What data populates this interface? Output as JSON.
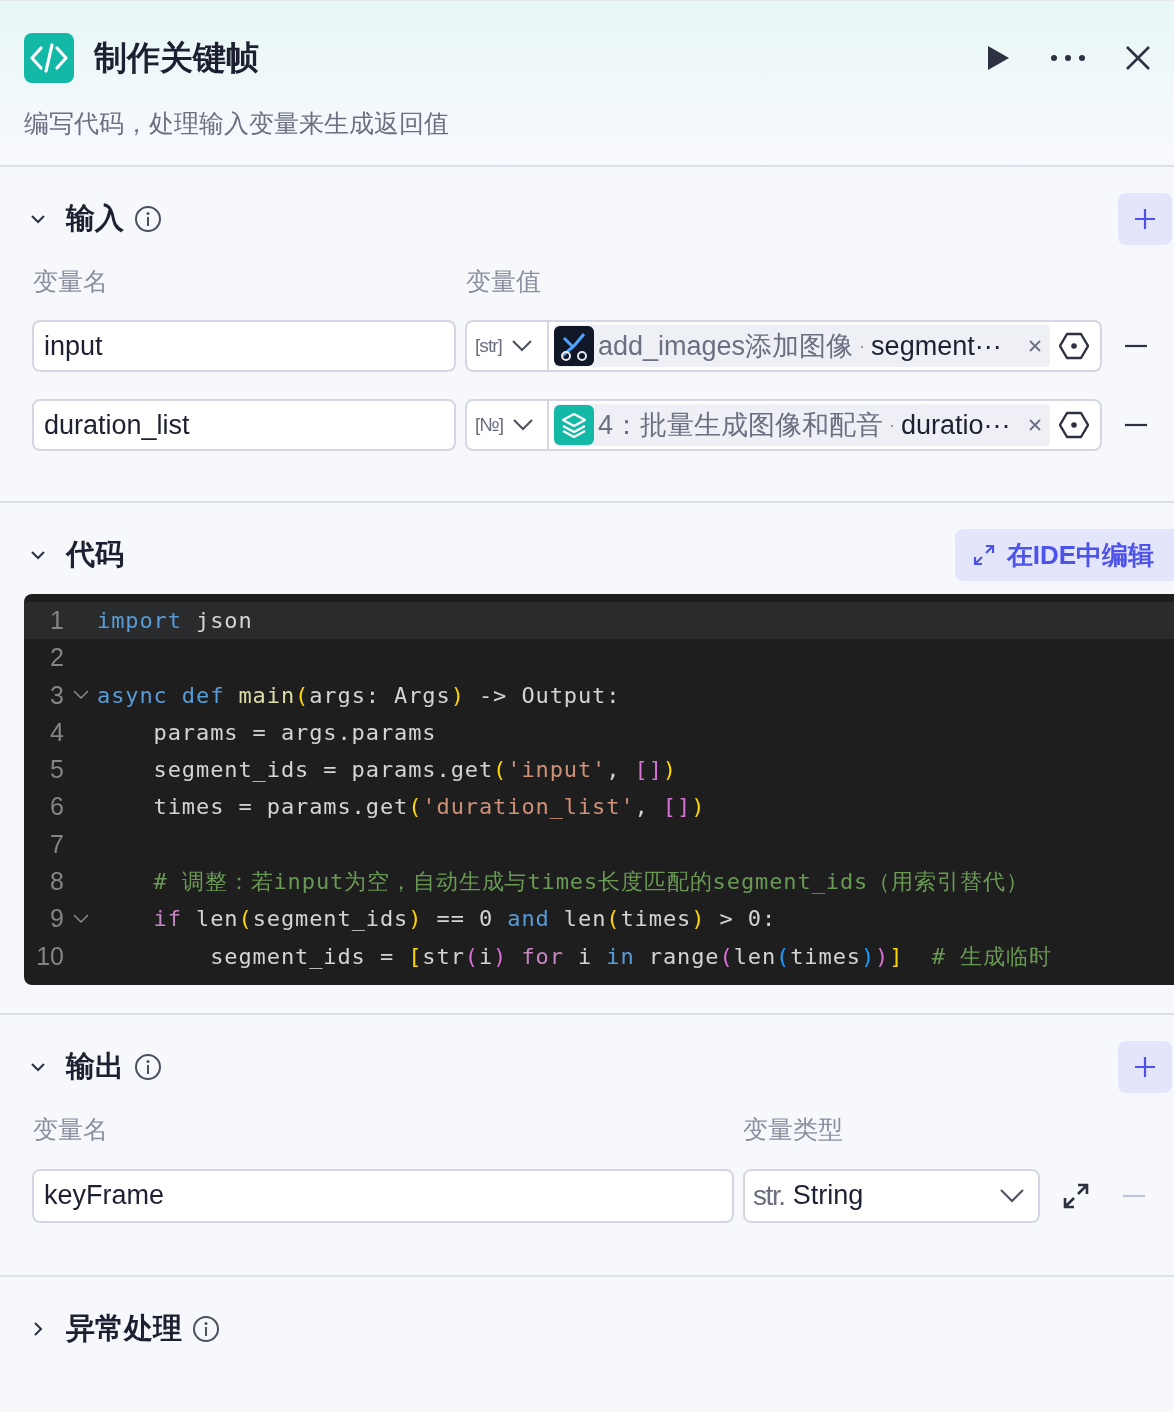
{
  "header": {
    "title": "制作关键帧",
    "description": "编写代码，处理输入变量来生成返回值"
  },
  "input": {
    "title": "输入",
    "expanded": true,
    "columns": [
      "变量名",
      "变量值"
    ],
    "rows": [
      {
        "name": "input",
        "type_tag": "[str]",
        "kind": "image",
        "source_node": "add_images添加图像",
        "separator": "·",
        "source_field": "segment···",
        "remove_disabled": false
      },
      {
        "name": "duration_list",
        "type_tag": "[№]",
        "kind": "layers",
        "source_node": "4：批量生成图像和配音",
        "separator": "·",
        "source_field": "duratio···",
        "remove_disabled": false
      }
    ]
  },
  "code": {
    "title": "代码",
    "expanded": true,
    "ide_button": "在IDE中编辑",
    "lines": [
      {
        "number": "1",
        "foldable": false,
        "tokens": [
          {
            "kind": "kw",
            "text": "import"
          },
          {
            "kind": "plain",
            "text": " json"
          }
        ]
      },
      {
        "number": "2",
        "foldable": false
      },
      {
        "number": "3",
        "foldable": true,
        "tokens": [
          {
            "kind": "kw",
            "text": "async def "
          },
          {
            "kind": "fn",
            "text": "main"
          },
          {
            "kind": "b1",
            "text": "("
          },
          {
            "kind": "plain",
            "text": "args: Args"
          },
          {
            "kind": "b1",
            "text": ")"
          },
          {
            "kind": "plain",
            "text": " -> Output:"
          }
        ]
      },
      {
        "number": "4",
        "foldable": false,
        "tokens": [
          {
            "kind": "plain",
            "text": "    params = args.params"
          }
        ]
      },
      {
        "number": "5",
        "foldable": false,
        "tokens": [
          {
            "kind": "plain",
            "text": "    segment_ids = params.get"
          },
          {
            "kind": "b1",
            "text": "("
          },
          {
            "kind": "str",
            "text": "'input'"
          },
          {
            "kind": "plain",
            "text": ", "
          },
          {
            "kind": "b2",
            "text": "[]"
          },
          {
            "kind": "b1",
            "text": ")"
          }
        ]
      },
      {
        "number": "6",
        "foldable": false,
        "tokens": [
          {
            "kind": "plain",
            "text": "    times = params.get"
          },
          {
            "kind": "b1",
            "text": "("
          },
          {
            "kind": "str",
            "text": "'duration_list'"
          },
          {
            "kind": "plain",
            "text": ", "
          },
          {
            "kind": "b2",
            "text": "[]"
          },
          {
            "kind": "b1",
            "text": ")"
          }
        ]
      },
      {
        "number": "7",
        "foldable": false
      },
      {
        "number": "8",
        "foldable": false,
        "tokens": [
          {
            "kind": "comment",
            "text": "    # 调整：若input为空，自动生成与times长度匹配的segment_ids（用索引替代）"
          }
        ]
      },
      {
        "number": "9",
        "foldable": true,
        "tokens": [
          {
            "kind": "ctrl",
            "text": "    if"
          },
          {
            "kind": "plain",
            "text": " len"
          },
          {
            "kind": "b1",
            "text": "("
          },
          {
            "kind": "plain",
            "text": "segment_ids"
          },
          {
            "kind": "b1",
            "text": ")"
          },
          {
            "kind": "plain",
            "text": " == 0 "
          },
          {
            "kind": "kw",
            "text": "and"
          },
          {
            "kind": "plain",
            "text": " len"
          },
          {
            "kind": "b1",
            "text": "("
          },
          {
            "kind": "plain",
            "text": "times"
          },
          {
            "kind": "b1",
            "text": ")"
          },
          {
            "kind": "plain",
            "text": " > 0:"
          }
        ]
      },
      {
        "number": "10",
        "foldable": false,
        "tokens": [
          {
            "kind": "plain",
            "text": "        segment_ids = "
          },
          {
            "kind": "b1",
            "text": "["
          },
          {
            "kind": "plain",
            "text": "str"
          },
          {
            "kind": "b2",
            "text": "("
          },
          {
            "kind": "plain",
            "text": "i"
          },
          {
            "kind": "b2",
            "text": ")"
          },
          {
            "kind": "ctrl",
            "text": " for"
          },
          {
            "kind": "plain",
            "text": " i "
          },
          {
            "kind": "kw",
            "text": "in"
          },
          {
            "kind": "plain",
            "text": " range"
          },
          {
            "kind": "b2",
            "text": "("
          },
          {
            "kind": "plain",
            "text": "len"
          },
          {
            "kind": "b3",
            "text": "("
          },
          {
            "kind": "plain",
            "text": "times"
          },
          {
            "kind": "b3",
            "text": ")"
          },
          {
            "kind": "b2",
            "text": ")"
          },
          {
            "kind": "b1",
            "text": "]"
          },
          {
            "kind": "comment",
            "text": "  # 生成临时"
          }
        ]
      }
    ]
  },
  "output": {
    "title": "输出",
    "expanded": true,
    "columns": [
      "变量名",
      "变量类型"
    ],
    "rows": [
      {
        "name": "keyFrame",
        "type_prefix": "str.",
        "type_label": "String",
        "remove_disabled": true
      }
    ]
  },
  "error_handling": {
    "title": "异常处理",
    "expanded": false
  }
}
